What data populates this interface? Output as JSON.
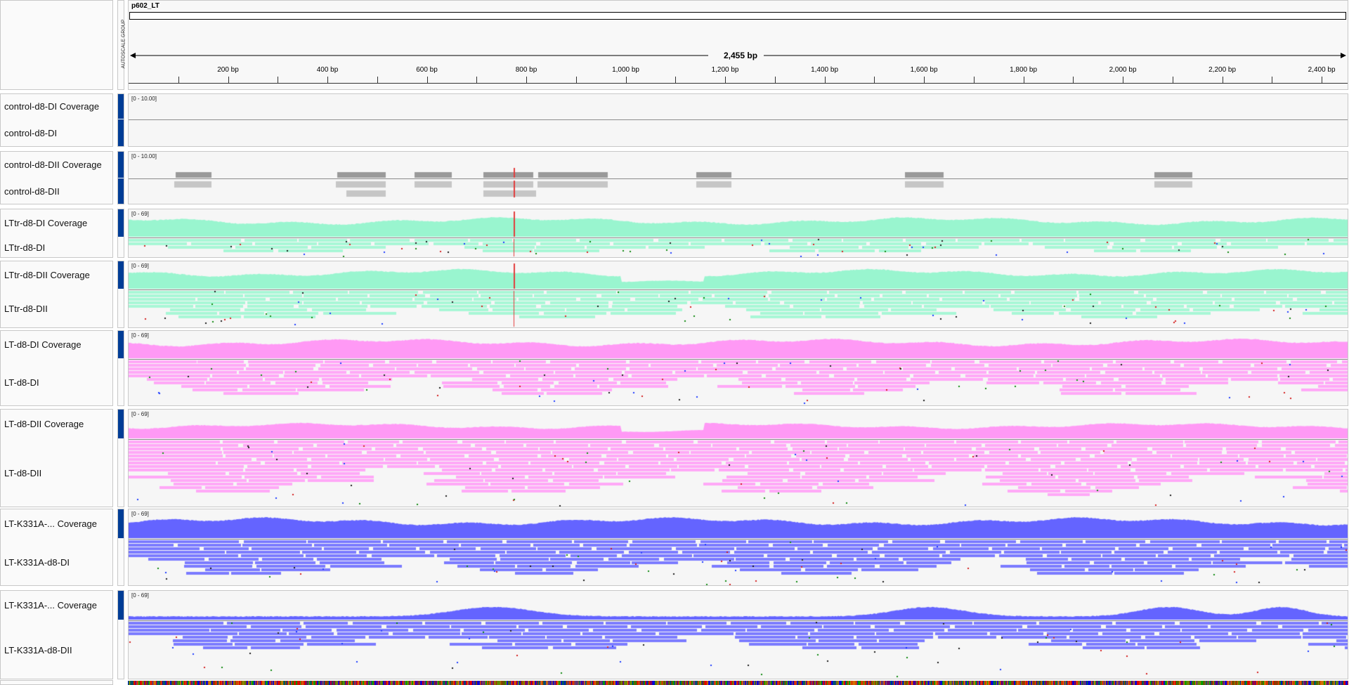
{
  "ruler": {
    "chrom": "p602_LT",
    "span": "2,455 bp",
    "autoscale": "AUTOSCALE GROUP",
    "ticks": [
      "200 bp",
      "400 bp",
      "600 bp",
      "800 bp",
      "1,000 bp",
      "1,200 bp",
      "1,400 bp",
      "1,600 bp",
      "1,800 bp",
      "2,000 bp",
      "2,200 bp",
      "2,400 bp"
    ]
  },
  "tracks": [
    {
      "coverage": "control-d8-DI Coverage",
      "reads": "control-d8-DI",
      "range": "[0 - 10.00]",
      "color": "#b4b4b4",
      "level": 0
    },
    {
      "coverage": "control-d8-DII Coverage",
      "reads": "control-d8-DII",
      "range": "[0 - 10.00]",
      "color": "#b4b4b4",
      "level": 0.1
    },
    {
      "coverage": "LTtr-d8-DI Coverage",
      "reads": "LTtr-d8-DI",
      "range": "[0 - 69]",
      "color": "#99f5cf",
      "level": 0.8
    },
    {
      "coverage": "LTtr-d8-DII Coverage",
      "reads": "LTtr-d8-DII",
      "range": "[0 - 69]",
      "color": "#99f5cf",
      "level": 0.8
    },
    {
      "coverage": "LT-d8-DI Coverage",
      "reads": "LT-d8-DI",
      "range": "[0 - 69]",
      "color": "#ff99f5",
      "level": 0.8
    },
    {
      "coverage": "LT-d8-DII Coverage",
      "reads": "LT-d8-DII",
      "range": "[0 - 69]",
      "color": "#ff99f5",
      "level": 0.6
    },
    {
      "coverage": "LT-K331A-... Coverage",
      "reads": "LT-K331A-d8-DI",
      "range": "[0 - 69]",
      "color": "#6464ff",
      "level": 0.8
    },
    {
      "coverage": "LT-K331A-... Coverage",
      "reads": "LT-K331A-d8-DII",
      "range": "[0 - 69]",
      "color": "#6464ff",
      "level": 0.3
    }
  ]
}
